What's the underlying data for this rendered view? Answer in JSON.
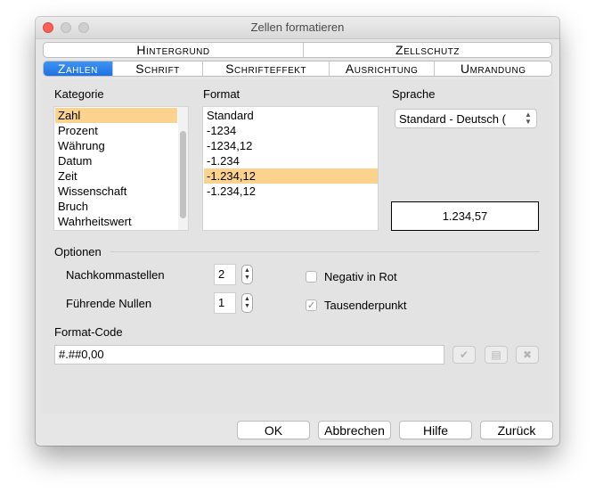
{
  "window": {
    "title": "Zellen formatieren"
  },
  "tabs_row1": [
    {
      "label": "Hintergrund"
    },
    {
      "label": "Zellschutz"
    }
  ],
  "tabs_row2": [
    {
      "label": "Zahlen",
      "active": true
    },
    {
      "label": "Schrift"
    },
    {
      "label": "Schrifteffekt"
    },
    {
      "label": "Ausrichtung"
    },
    {
      "label": "Umrandung"
    }
  ],
  "kategorie": {
    "label": "Kategorie",
    "items": [
      "Zahl",
      "Prozent",
      "Währung",
      "Datum",
      "Zeit",
      "Wissenschaft",
      "Bruch",
      "Wahrheitswert"
    ],
    "selected_index": 0
  },
  "format": {
    "label": "Format",
    "items": [
      "Standard",
      "-1234",
      "-1234,12",
      "-1.234",
      "-1.234,12",
      "-1.234,12"
    ],
    "selected_index": 4
  },
  "sprache": {
    "label": "Sprache",
    "value": "Standard - Deutsch (",
    "preview": "1.234,57"
  },
  "optionen": {
    "label": "Optionen",
    "nachkommastellen_label": "Nachkommastellen",
    "nachkommastellen_value": "2",
    "fuehrende_nullen_label": "Führende Nullen",
    "fuehrende_nullen_value": "1",
    "negativ_label": "Negativ in Rot",
    "negativ_checked": false,
    "tausender_label": "Tausenderpunkt",
    "tausender_checked": true
  },
  "format_code": {
    "label": "Format-Code",
    "value": "#.##0,00"
  },
  "buttons": {
    "ok": "OK",
    "cancel": "Abbrechen",
    "help": "Hilfe",
    "reset": "Zurück"
  },
  "colors": {
    "selection": "#fbd28e",
    "tab_active": "#1c72e4",
    "window_bg": "#e6e6e6"
  }
}
